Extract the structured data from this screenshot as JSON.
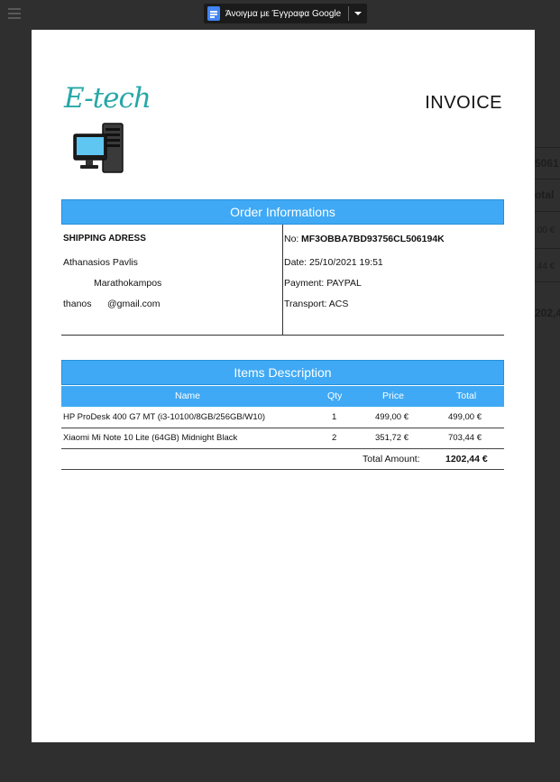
{
  "viewer": {
    "open_with_label": "Άνοιγμα με Έγγραφα Google"
  },
  "background_page": {
    "fragments": [
      "5061",
      "otal",
      ".00 €",
      ".44 €",
      "202,4"
    ]
  },
  "invoice": {
    "logo_text": "E-tech",
    "title": "INVOICE",
    "order_section_title": "Order Informations",
    "shipping": {
      "heading": "SHIPPING ADRESS",
      "name": "Athanasios Pavlis",
      "address": "Marathokampos",
      "email_prefix": "thanos",
      "email_suffix": "@gmail.com"
    },
    "order": {
      "number_label": "No:",
      "number_value": "MF3OBBA7BD93756CL506194K",
      "date": "Date: 25/10/2021 19:51",
      "payment": "Payment: PAYPAL",
      "transport": "Transport: ACS"
    },
    "items_section_title": "Items Description",
    "columns": {
      "name": "Name",
      "qty": "Qty",
      "price": "Price",
      "total": "Total"
    },
    "items": [
      {
        "name": "HP ProDesk 400 G7 MT (i3-10100/8GB/256GB/W10)",
        "qty": "1",
        "price": "499,00 €",
        "total": "499,00 €"
      },
      {
        "name": "Xiaomi Mi Note 10 Lite (64GB) Midnight Black",
        "qty": "2",
        "price": "351,72 €",
        "total": "703,44 €"
      }
    ],
    "total_label": "Total Amount:",
    "total_value": "1202,44 €"
  },
  "colors": {
    "accent": "#3fa9f5",
    "logo": "#27a7a7",
    "backdrop": "#2f2f2f"
  }
}
